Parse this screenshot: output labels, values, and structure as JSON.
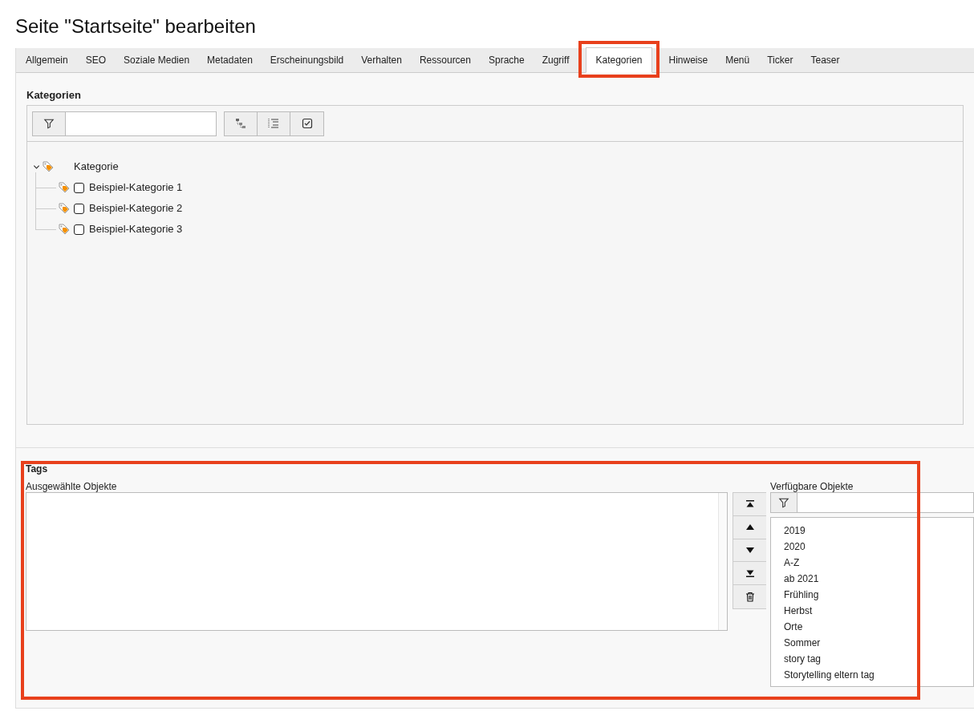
{
  "title": "Seite \"Startseite\" bearbeiten",
  "tabs": [
    {
      "label": "Allgemein",
      "selected": false
    },
    {
      "label": "SEO",
      "selected": false
    },
    {
      "label": "Soziale Medien",
      "selected": false
    },
    {
      "label": "Metadaten",
      "selected": false
    },
    {
      "label": "Erscheinungsbild",
      "selected": false
    },
    {
      "label": "Verhalten",
      "selected": false
    },
    {
      "label": "Ressourcen",
      "selected": false
    },
    {
      "label": "Sprache",
      "selected": false
    },
    {
      "label": "Zugriff",
      "selected": false
    },
    {
      "label": "Kategorien",
      "selected": true
    },
    {
      "label": "Hinweise",
      "selected": false
    },
    {
      "label": "Menü",
      "selected": false
    },
    {
      "label": "Ticker",
      "selected": false
    },
    {
      "label": "Teaser",
      "selected": false
    }
  ],
  "categories": {
    "heading": "Kategorien",
    "tree": {
      "label": "Kategorie",
      "expanded": true,
      "children": [
        {
          "label": "Beispiel-Kategorie 1",
          "checked": false
        },
        {
          "label": "Beispiel-Kategorie 2",
          "checked": false
        },
        {
          "label": "Beispiel-Kategorie 3",
          "checked": false
        }
      ]
    }
  },
  "tags": {
    "heading": "Tags",
    "selected_label": "Ausgewählte Objekte",
    "available_label": "Verfügbare Objekte",
    "available": [
      "2019",
      "2020",
      "A-Z",
      "ab 2021",
      "Frühling",
      "Herbst",
      "Orte",
      "Sommer",
      "story tag",
      "Storytelling eltern tag"
    ]
  }
}
